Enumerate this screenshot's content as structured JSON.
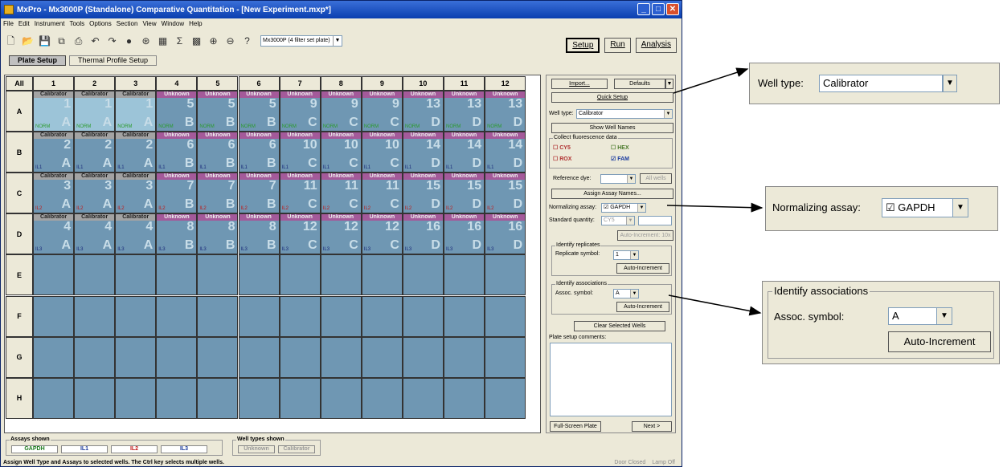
{
  "window": {
    "title": "MxPro - Mx3000P (Standalone) Comparative Quantitation - [New Experiment.mxp*]"
  },
  "menu": [
    "File",
    "Edit",
    "Instrument",
    "Tools",
    "Options",
    "Section",
    "View",
    "Window",
    "Help"
  ],
  "toolbar": {
    "plate_select": "Mx3000P (4 filter set plate)"
  },
  "main_buttons": {
    "setup": "Setup",
    "run": "Run",
    "analysis": "Analysis"
  },
  "tabs": {
    "plate_setup": "Plate Setup",
    "thermal": "Thermal Profile Setup"
  },
  "grid": {
    "all_label": "All",
    "columns": [
      "1",
      "2",
      "3",
      "4",
      "5",
      "6",
      "7",
      "8",
      "9",
      "10",
      "11",
      "12"
    ],
    "rows": [
      "A",
      "B",
      "C",
      "D",
      "E",
      "F",
      "G",
      "H"
    ],
    "well_rows": [
      {
        "assay": "NORM",
        "replicates": [
          "1",
          "1",
          "1",
          "5",
          "5",
          "5",
          "9",
          "9",
          "9",
          "13",
          "13",
          "13"
        ],
        "letters": [
          "A",
          "A",
          "A",
          "B",
          "B",
          "B",
          "C",
          "C",
          "C",
          "D",
          "D",
          "D"
        ]
      },
      {
        "assay": "IL1",
        "replicates": [
          "2",
          "2",
          "2",
          "6",
          "6",
          "6",
          "10",
          "10",
          "10",
          "14",
          "14",
          "14"
        ],
        "letters": [
          "A",
          "A",
          "A",
          "B",
          "B",
          "B",
          "C",
          "C",
          "C",
          "D",
          "D",
          "D"
        ]
      },
      {
        "assay": "IL2",
        "replicates": [
          "3",
          "3",
          "3",
          "7",
          "7",
          "7",
          "11",
          "11",
          "11",
          "15",
          "15",
          "15"
        ],
        "letters": [
          "A",
          "A",
          "A",
          "B",
          "B",
          "B",
          "C",
          "C",
          "C",
          "D",
          "D",
          "D"
        ]
      },
      {
        "assay": "IL3",
        "replicates": [
          "4",
          "4",
          "4",
          "8",
          "8",
          "8",
          "12",
          "12",
          "12",
          "16",
          "16",
          "16"
        ],
        "letters": [
          "A",
          "A",
          "A",
          "B",
          "B",
          "B",
          "C",
          "C",
          "C",
          "D",
          "D",
          "D"
        ]
      }
    ],
    "type_calibrator": "Calibrator",
    "type_unknown": "Unknown"
  },
  "panel": {
    "import": "Import...",
    "defaults": "Defaults",
    "quick_setup": "Quick Setup",
    "well_type_label": "Well type:",
    "well_type_value": "Calibrator",
    "show_well_names": "Show Well Names",
    "collect_title": "Collect fluorescence data",
    "dyes": {
      "cy5": "CY5",
      "hex": "HEX",
      "rox": "ROX",
      "fam": "FAM"
    },
    "reference_dye": "Reference dye:",
    "all_wells": "All wells",
    "assign_assay": "Assign Assay Names...",
    "normalizing_label": "Normalizing assay:",
    "normalizing_value": "GAPDH",
    "std_qty_label": "Standard quantity:",
    "std_qty_value": "CY5",
    "auto_inc_10x": "Auto-Increment: 10x",
    "identify_replicates": "Identify replicates",
    "replicate_symbol": "Replicate symbol:",
    "replicate_value": "1",
    "auto_increment": "Auto-Increment",
    "identify_assoc": "Identify associations",
    "assoc_symbol": "Assoc. symbol:",
    "assoc_value": "A",
    "clear_wells": "Clear Selected Wells",
    "comments_label": "Plate setup comments:",
    "fullscreen": "Full-Screen Plate",
    "next": "Next >"
  },
  "bottom": {
    "assays_title": "Assays shown",
    "assays": [
      {
        "name": "GAPDH",
        "color": "#1a7a1a"
      },
      {
        "name": "IL1",
        "color": "#1a3a9a"
      },
      {
        "name": "IL2",
        "color": "#c01818"
      },
      {
        "name": "IL3",
        "color": "#1a3a9a"
      }
    ],
    "welltypes_title": "Well types shown",
    "welltypes": [
      "Unknown",
      "Calibrator"
    ]
  },
  "status": {
    "message": "Assign Well Type and Assays to selected wells. The Ctrl key selects multiple wells.",
    "door": "Door Closed",
    "lamp": "Lamp Off"
  },
  "zoom": {
    "well_type_label": "Well type:",
    "well_type_value": "Calibrator",
    "normalizing_label": "Normalizing assay:",
    "normalizing_value": "GAPDH",
    "assoc_title": "Identify associations",
    "assoc_label": "Assoc. symbol:",
    "assoc_value": "A",
    "auto_increment": "Auto-Increment"
  },
  "colors": {
    "well": "#6f97b3",
    "well_selected": "#9cc4d8",
    "unknown": "#a45a9a",
    "calibrator": "#a3a3a3"
  }
}
